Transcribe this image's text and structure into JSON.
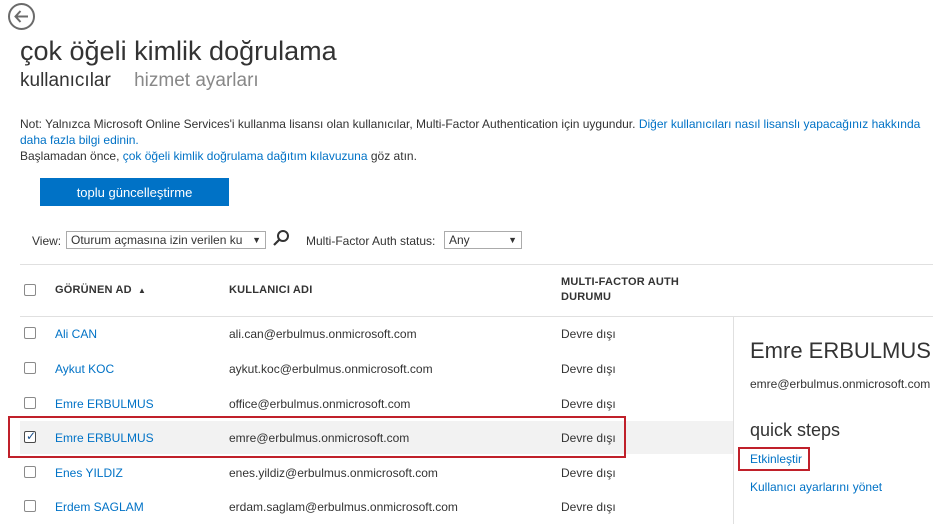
{
  "header": {
    "title": "çok öğeli kimlik doğrulama",
    "tabs": [
      {
        "label": "kullanıcılar",
        "active": true
      },
      {
        "label": "hizmet ayarları",
        "active": false
      }
    ]
  },
  "note": {
    "line1_text": "Not: Yalnızca Microsoft Online Services'i kullanma lisansı olan kullanıcılar, Multi-Factor Authentication için uygundur.",
    "line1_link": "Diğer kullanıcıları nasıl lisanslı yapacağınız hakkında daha fazla bilgi edinin.",
    "line2_prefix": "Başlamadan önce,",
    "line2_link": "çok öğeli kimlik doğrulama dağıtım kılavuzuna",
    "line2_suffix": "göz atın."
  },
  "toolbar": {
    "bulk_update_label": "toplu güncelleştirme",
    "view_label": "View:",
    "view_value": "Oturum açmasına izin verilen ku",
    "mfa_status_label": "Multi-Factor Auth status:",
    "mfa_status_value": "Any"
  },
  "table": {
    "columns": {
      "display_name": "GÖRÜNEN AD",
      "sort_indicator": "▲",
      "username": "KULLANICI ADI",
      "mfa_status_line1": "MULTI-FACTOR AUTH",
      "mfa_status_line2": "DURUMU"
    },
    "rows": [
      {
        "name": "Ali CAN",
        "username": "ali.can@erbulmus.onmicrosoft.com",
        "status": "Devre dışı",
        "checked": false
      },
      {
        "name": "Aykut KOC",
        "username": "aykut.koc@erbulmus.onmicrosoft.com",
        "status": "Devre dışı",
        "checked": false
      },
      {
        "name": "Emre ERBULMUS",
        "username": "office@erbulmus.onmicrosoft.com",
        "status": "Devre dışı",
        "checked": false
      },
      {
        "name": "Emre ERBULMUS",
        "username": "emre@erbulmus.onmicrosoft.com",
        "status": "Devre dışı",
        "checked": true
      },
      {
        "name": "Enes YILDIZ",
        "username": "enes.yildiz@erbulmus.onmicrosoft.com",
        "status": "Devre dışı",
        "checked": false
      },
      {
        "name": "Erdem SAGLAM",
        "username": "erdam.saglam@erbulmus.onmicrosoft.com",
        "status": "Devre dışı",
        "checked": false
      }
    ]
  },
  "detail": {
    "name": "Emre ERBULMUS",
    "email": "emre@erbulmus.onmicrosoft.com",
    "quick_steps_label": "quick steps",
    "enable_link": "Etkinleştir",
    "manage_settings_link": "Kullanıcı ayarlarını yönet"
  },
  "colors": {
    "accent": "#0072c6",
    "highlight_border": "#c0202a",
    "selected_row_bg": "#f2f2f2"
  },
  "icons": {
    "back": "back-arrow-icon",
    "search": "search-icon",
    "dropdown": "chevron-down-icon",
    "sort": "sort-ascending-icon"
  }
}
